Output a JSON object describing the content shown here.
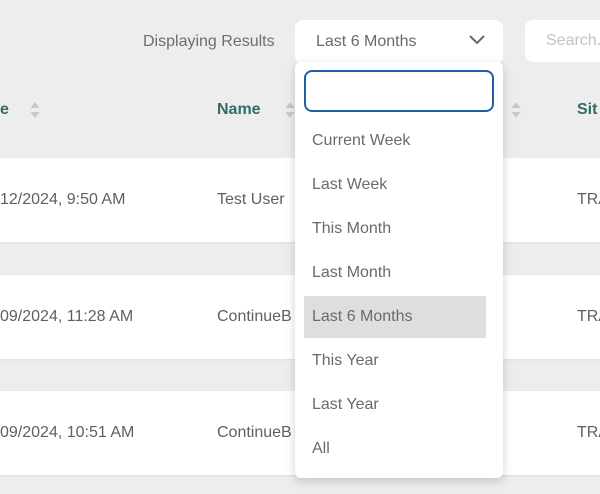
{
  "filter": {
    "label": "Displaying Results",
    "selected_range": "Last 6 Months",
    "search_placeholder": "Search..."
  },
  "table": {
    "headers": [
      "e",
      "Name",
      "Sit"
    ],
    "rows": [
      {
        "date": "12/2024, 9:50 AM",
        "name": "Test User",
        "site": "TRA"
      },
      {
        "date": "09/2024, 11:28 AM",
        "name": "ContinueB",
        "site": "TRA"
      },
      {
        "date": "09/2024, 10:51 AM",
        "name": "ContinueB",
        "site": "TRA"
      }
    ]
  },
  "dropdown": {
    "search_value": "",
    "options": [
      "Current Week",
      "Last Week",
      "This Month",
      "Last Month",
      "Last 6 Months",
      "This Year",
      "Last Year",
      "All"
    ],
    "selected": "Last 6 Months"
  },
  "colors": {
    "background": "#ededed",
    "header_text": "#2f6e66",
    "focus_border": "#1f5faa",
    "selected_option_bg": "#dedede"
  }
}
